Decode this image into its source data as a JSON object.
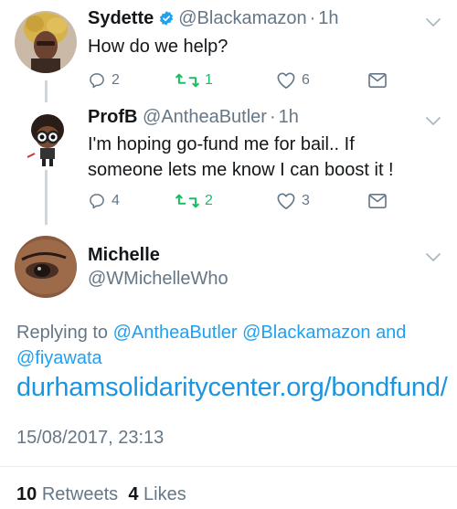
{
  "tweets": [
    {
      "name": "Sydette",
      "verified": true,
      "handle": "@Blackamazon",
      "separator": "·",
      "time": "1h",
      "text": "How do we help?",
      "replies": "2",
      "retweets": "1",
      "likes": "6"
    },
    {
      "name": "ProfB",
      "verified": false,
      "handle": "@AntheaButler",
      "separator": "·",
      "time": "1h",
      "text_line1": "I'm hoping go-fund me for bail.. If",
      "text_line2": "someone lets me know I can boost it !",
      "replies": "4",
      "retweets": "2",
      "likes": "3"
    }
  ],
  "main": {
    "name": "Michelle",
    "handle": "@WMichelleWho",
    "replying_prefix": "Replying to",
    "mentions": [
      "@AntheaButler",
      "@Blackamazon",
      "@fiyawata"
    ],
    "and_word": "and",
    "link": "durhamsolidaritycenter.org/bondfund/",
    "timestamp": "15/08/2017, 23:13",
    "retweet_count": "10",
    "retweet_label": "Retweets",
    "like_count": "4",
    "like_label": "Likes"
  },
  "colors": {
    "link": "#1b95e0",
    "retweet": "#17bf63",
    "secondary": "#657786",
    "thread_line": "#ccd6dd"
  },
  "icons": [
    "reply-icon",
    "retweet-icon",
    "like-icon",
    "direct-message-icon",
    "chevron-down-icon",
    "verified-badge-icon"
  ]
}
